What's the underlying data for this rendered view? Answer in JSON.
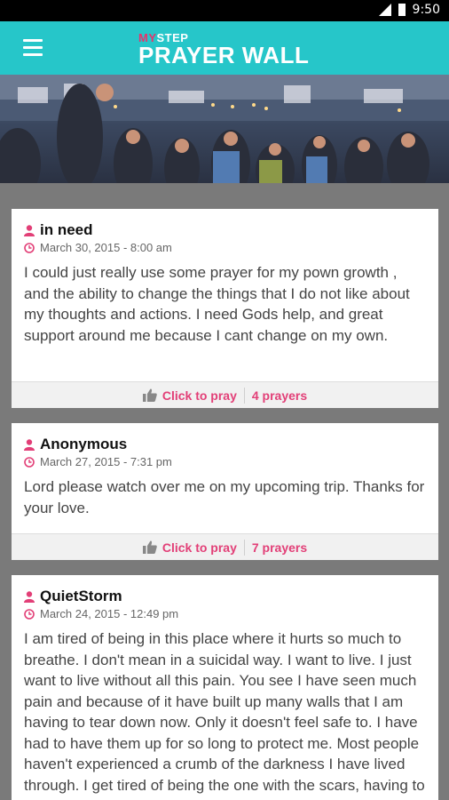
{
  "status_bar": {
    "time": "9:50"
  },
  "app_bar": {
    "brand_my": "MY",
    "brand_step": "STEP",
    "title": "PRAYER WALL"
  },
  "posts": [
    {
      "author": "in need",
      "date": "March 30, 2015 - 8:00 am",
      "message": "I could just really use some prayer for my pown growth , and the ability to change the things that I do not like about my thoughts and actions. I need Gods help, and great support around me because I cant change on my own.",
      "pray_label": "Click to pray",
      "prayers": "4 prayers"
    },
    {
      "author": "Anonymous",
      "date": "March 27, 2015 - 7:31 pm",
      "message": "Lord please watch over me on my upcoming trip. Thanks for your love.",
      "pray_label": "Click to pray",
      "prayers": "7 prayers"
    },
    {
      "author": "QuietStorm",
      "date": "March 24, 2015 - 12:49 pm",
      "message": "I am tired of being in this place where it hurts so much to breathe. I don't mean in a suicidal way. I want to live. I just want to live without all this pain. You see I have seen much pain and because of it have built up many walls that I am having to tear down now. Only it doesn't feel safe to. I have had to have them up for so long to protect me. Most people haven't experienced a crumb of the darkness I have lived through. I get tired of being the one with the scars, having to move forward when nothing feels right."
    }
  ],
  "colors": {
    "teal": "#26c6c9",
    "accent": "#e23f77"
  },
  "icons": [
    "hamburger-menu-icon",
    "user-icon",
    "clock-icon",
    "thumbs-up-icon"
  ]
}
